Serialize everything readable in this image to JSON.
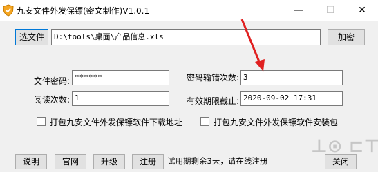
{
  "window": {
    "title": "九安文件外发保镖(密文制作)V1.0.1",
    "minimize_glyph": "—",
    "maximize_glyph": "☐",
    "close_glyph": "✕"
  },
  "file_row": {
    "select_label": "选文件",
    "path_value": "D:\\tools\\桌面\\产品信息.xls",
    "encrypt_label": "加密"
  },
  "settings": {
    "password_label": "文件密码:",
    "password_value": "******",
    "error_count_label": "密码输错次数:",
    "error_count_value": "3",
    "read_count_label": "阅读次数:",
    "read_count_value": "1",
    "expire_label": "有效期限截止:",
    "expire_value": "2020-09-02 17:31",
    "pack_download_label": "打包九安文件外发保镖软件下载地址",
    "pack_installer_label": "打包九安文件外发保镖软件安装包"
  },
  "bottom": {
    "help_label": "说明",
    "website_label": "官网",
    "upgrade_label": "升级",
    "register_label": "注册",
    "trial_text": "试用期剩余3天，请在线注册",
    "close_label": "关闭"
  },
  "colors": {
    "annotation_arrow": "#e02020",
    "focus_border": "#0078d7"
  }
}
